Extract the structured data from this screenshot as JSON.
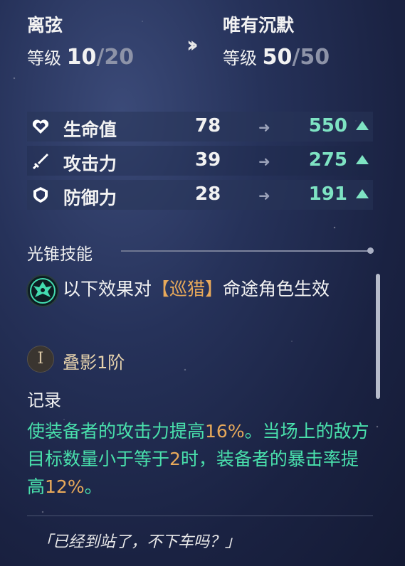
{
  "current": {
    "name": "离弦",
    "level_label": "等级",
    "level": "10",
    "level_sep": "/",
    "level_max": "20"
  },
  "target": {
    "name": "唯有沉默",
    "level_label": "等级",
    "level": "50",
    "level_sep": "/",
    "level_max": "50"
  },
  "stats": [
    {
      "icon": "heart-icon",
      "label": "生命值",
      "old": "78",
      "new": "550"
    },
    {
      "icon": "sword-icon",
      "label": "攻击力",
      "old": "39",
      "new": "275"
    },
    {
      "icon": "shield-icon",
      "label": "防御力",
      "old": "28",
      "new": "191"
    }
  ],
  "skill": {
    "section_title": "光锥技能",
    "effect_prefix": "以下效果对",
    "effect_path": "【巡猎】",
    "effect_suffix": "命途角色生效",
    "rank_numeral": "I",
    "rank_text": "叠影1阶"
  },
  "record": {
    "title": "记录",
    "p1": "使装备者的攻击力提高",
    "v1": "16%",
    "p2": "。当场上的敌方目标数量小于等于",
    "v2": "2",
    "p3": "时，装备者的暴击率提高",
    "v3": "12%",
    "p4": "。"
  },
  "quote": "「已经到站了，不下车吗？」",
  "colors": {
    "accent_green": "#49e0ac",
    "accent_orange": "#e8a95a",
    "stat_new": "#7ee3c3"
  }
}
